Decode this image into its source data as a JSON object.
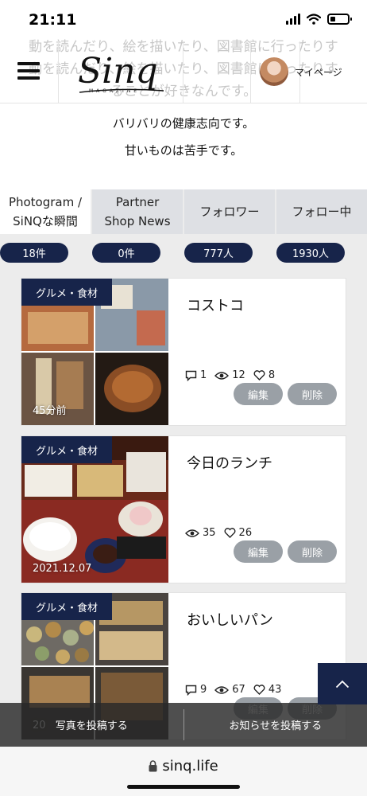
{
  "status_bar": {
    "time": "21:11"
  },
  "header": {
    "behind_text": [
      "動を読んだり、絵を描いたり、図書館に行ったりす",
      "ることが好きなんです。"
    ],
    "logo_text": "Sinq",
    "logo_sub": "MAGAZINE",
    "mypage_label": "マイページ"
  },
  "profile": {
    "lines": [
      "バリバリの健康志向です。",
      "甘いものは苦手です。"
    ]
  },
  "tabs": [
    {
      "line1": "Photogram /",
      "line2": "SiNQな瞬間",
      "count": "18件",
      "active": true
    },
    {
      "line1": "Partner",
      "line2": "Shop News",
      "count": "0件",
      "active": false
    },
    {
      "line1": "フォロワー",
      "line2": "",
      "count": "777人",
      "active": false
    },
    {
      "line1": "フォロー中",
      "line2": "",
      "count": "1930人",
      "active": false
    }
  ],
  "posts": [
    {
      "category": "グルメ・食材",
      "title": "コストコ",
      "date": "45分前",
      "comments": "1",
      "views": "12",
      "likes": "8",
      "edit": "編集",
      "delete": "削除"
    },
    {
      "category": "グルメ・食材",
      "title": "今日のランチ",
      "date": "2021.12.07",
      "views": "35",
      "likes": "26",
      "edit": "編集",
      "delete": "削除"
    },
    {
      "category": "グルメ・食材",
      "title": "おいしいパン",
      "date": "20",
      "comments": "9",
      "views": "67",
      "likes": "43",
      "edit": "編集",
      "delete": "削除"
    }
  ],
  "action_bar": {
    "post_photo": "写真を投稿する",
    "post_news": "お知らせを投稿する"
  },
  "browser": {
    "url": "sinq.life"
  },
  "colors": {
    "navy": "#17244a",
    "tab_gray": "#dee0e4",
    "button_gray": "#9aa0a6"
  }
}
